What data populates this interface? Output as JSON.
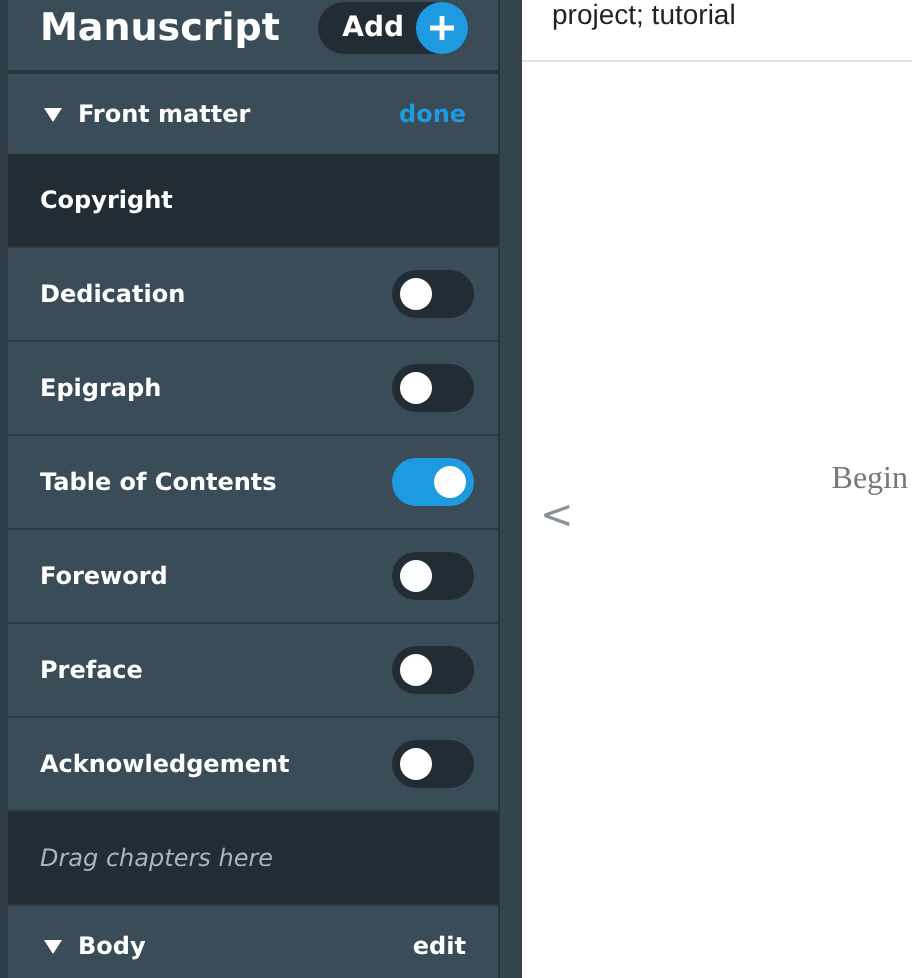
{
  "sidebar": {
    "title": "Manuscript",
    "add_button": "Add",
    "sections": [
      {
        "title": "Front matter",
        "expanded": true,
        "action": "done",
        "items": [
          {
            "kind": "plain",
            "label": "Copyright"
          },
          {
            "kind": "toggle",
            "label": "Dedication",
            "on": false
          },
          {
            "kind": "toggle",
            "label": "Epigraph",
            "on": false
          },
          {
            "kind": "toggle",
            "label": "Table of Contents",
            "on": true
          },
          {
            "kind": "toggle",
            "label": "Foreword",
            "on": false
          },
          {
            "kind": "toggle",
            "label": "Preface",
            "on": false
          },
          {
            "kind": "toggle",
            "label": "Acknowledgement",
            "on": false
          },
          {
            "kind": "dropzone",
            "label": "Drag chapters here"
          }
        ]
      },
      {
        "title": "Body",
        "expanded": true,
        "action": "edit"
      }
    ]
  },
  "content": {
    "tags": "project; tutorial",
    "back_arrow": "<",
    "text": "Begin"
  }
}
